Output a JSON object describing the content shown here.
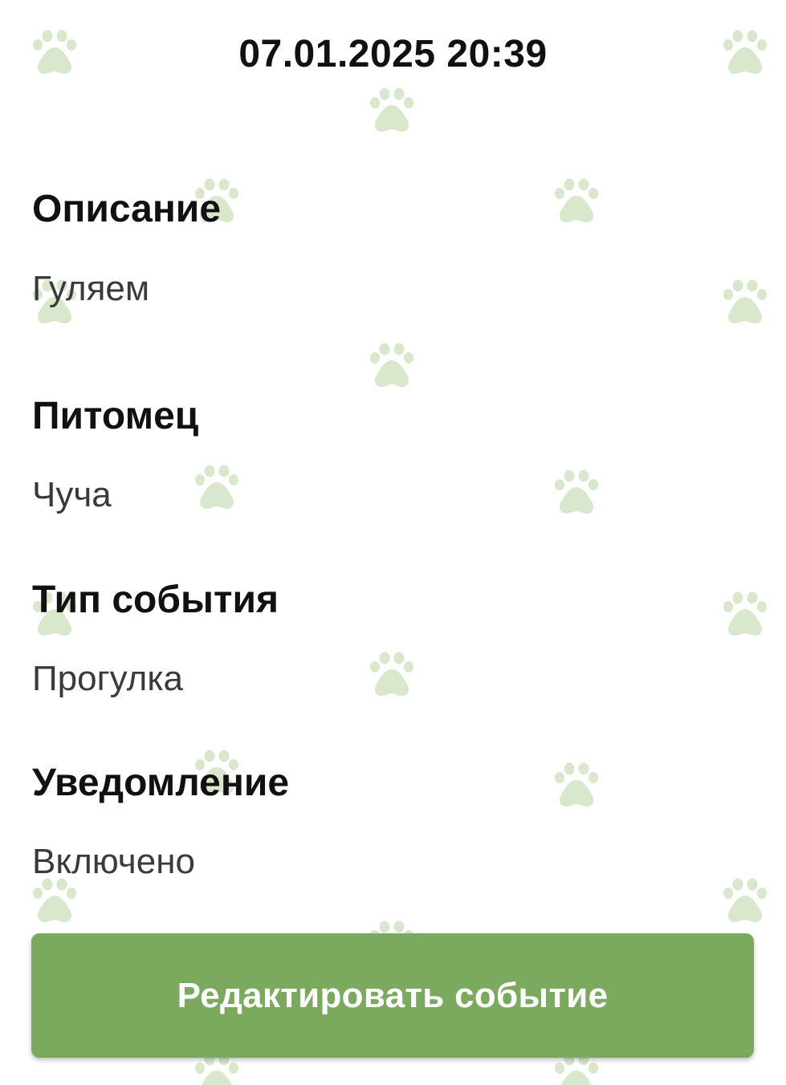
{
  "event": {
    "datetime": "07.01.2025 20:39",
    "fields": [
      {
        "label": "Описание",
        "value": "Гуляем"
      },
      {
        "label": "Питомец",
        "value": "Чуча"
      },
      {
        "label": "Тип события",
        "value": "Прогулка"
      },
      {
        "label": "Уведомление",
        "value": "Включено"
      }
    ],
    "edit_button_label": "Редактировать событие"
  },
  "colors": {
    "accent": "#7baa5e",
    "paw_pattern": "#d9e8cc",
    "label_text": "#111111",
    "value_text": "#3a3a3a"
  },
  "icons": {
    "background_pattern": "paw-icon"
  }
}
